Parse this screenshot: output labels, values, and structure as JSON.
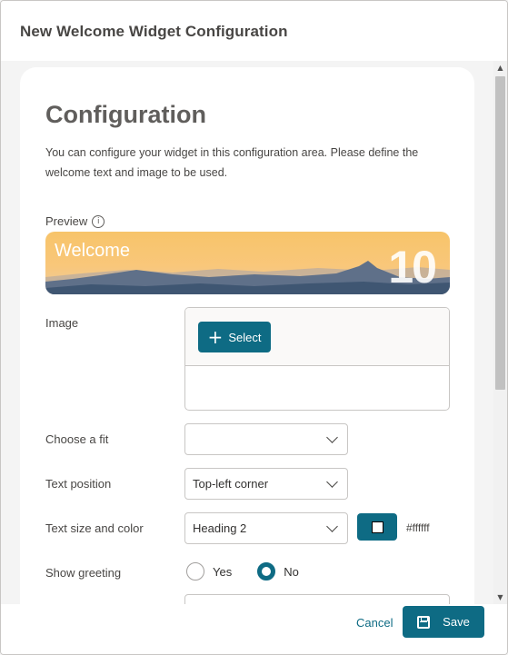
{
  "dialog": {
    "title": "New Welcome Widget Configuration"
  },
  "card": {
    "heading": "Configuration",
    "description": "You can configure your widget in this configuration area. Please define the welcome text and image to be used."
  },
  "preview": {
    "label": "Preview",
    "banner_text": "Welcome",
    "banner_number": "10"
  },
  "image": {
    "label": "Image",
    "select_label": "Select"
  },
  "fit": {
    "label": "Choose a fit",
    "value": ""
  },
  "text_position": {
    "label": "Text position",
    "value": "Top-left corner"
  },
  "text_size_color": {
    "label": "Text size and color",
    "value": "Heading 2",
    "color_hex": "#ffffff"
  },
  "greeting": {
    "label": "Show greeting",
    "options": [
      "Yes",
      "No"
    ],
    "selected": "No"
  },
  "footer": {
    "cancel_label": "Cancel",
    "save_label": "Save"
  },
  "colors": {
    "accent": "#0e6b84",
    "background": "#f4f4f4"
  }
}
